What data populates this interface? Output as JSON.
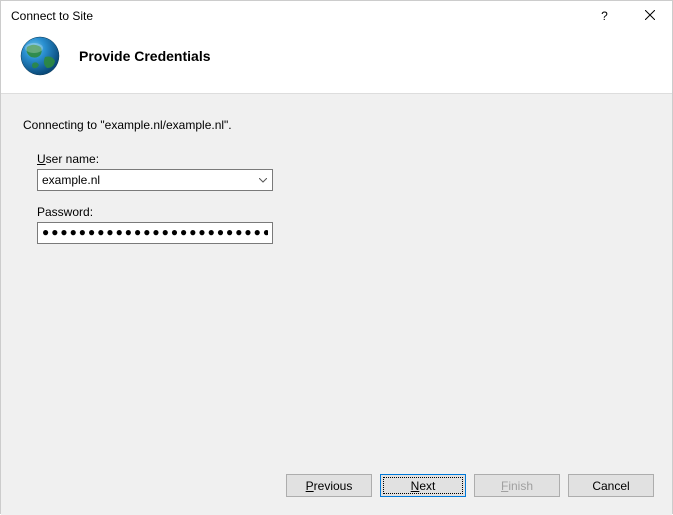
{
  "titlebar": {
    "title": "Connect to Site"
  },
  "header": {
    "title": "Provide Credentials"
  },
  "main": {
    "connecting_text": "Connecting to \"example.nl/example.nl\".",
    "username_label_pre": "U",
    "username_label_post": "ser name:",
    "username_value": "example.nl",
    "password_label": "Password:",
    "password_value": "●●●●●●●●●●●●●●●●●●●●●●●●●●"
  },
  "footer": {
    "previous_pre": "P",
    "previous_post": "revious",
    "next_pre": "N",
    "next_post": "ext",
    "finish_pre": "F",
    "finish_post": "inish",
    "cancel": "Cancel"
  }
}
